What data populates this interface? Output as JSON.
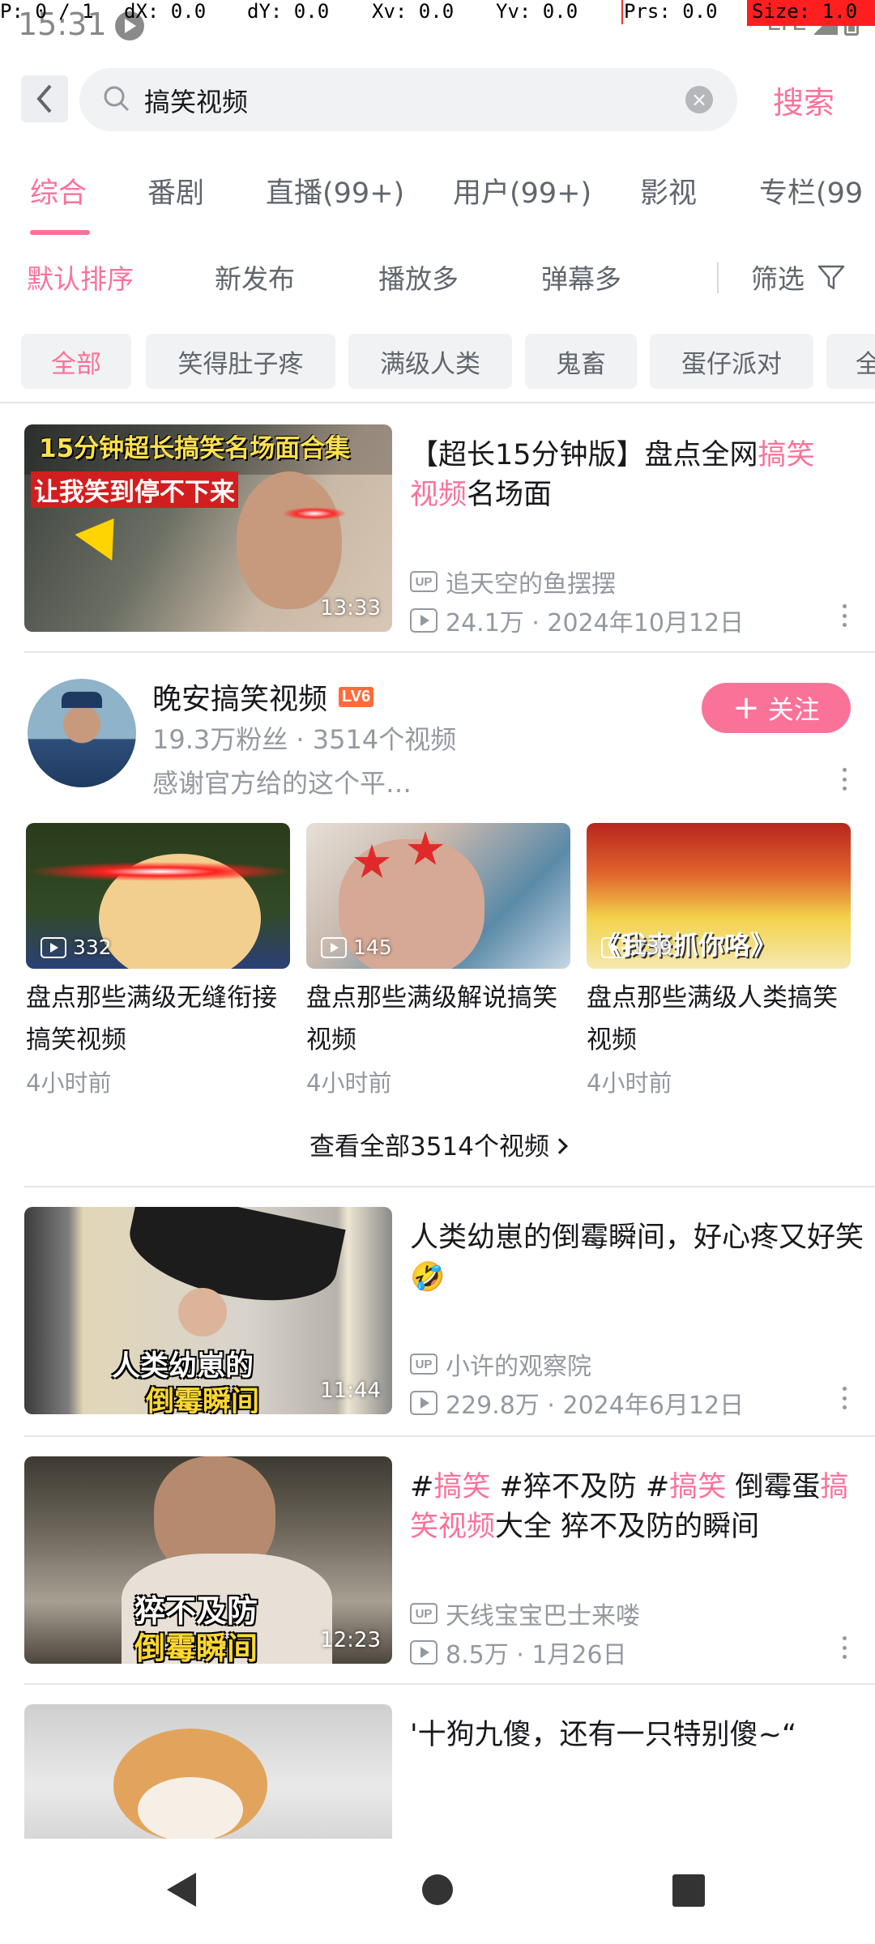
{
  "status_bar": {
    "time": "15:31",
    "network": "LTE"
  },
  "debug": {
    "p": "P: 0 / 1",
    "dx": "dX: 0.0",
    "dy": "dY: 0.0",
    "xv": "Xv: 0.0",
    "yv": "Yv: 0.0",
    "prs": "Prs: 0.0",
    "size": "Size: 1.0"
  },
  "search": {
    "query": "搞笑视频",
    "submit_label": "搜索"
  },
  "tabs": [
    "综合",
    "番剧",
    "直播(99+)",
    "用户(99+)",
    "影视",
    "专栏(99"
  ],
  "sort": {
    "options": [
      "默认排序",
      "新发布",
      "播放多",
      "弹幕多"
    ],
    "filter_label": "筛选"
  },
  "chips": [
    "全部",
    "笑得肚子疼",
    "满级人类",
    "鬼畜",
    "蛋仔派对",
    "全"
  ],
  "videos": [
    {
      "title_parts": [
        "【超长15分钟版】盘点全网",
        "搞笑",
        "\n",
        "视频",
        "名场面"
      ],
      "thumb_text_1": "15分钟超长搞笑名场面合集",
      "thumb_text_2": "让我笑到停不下来",
      "duration": "13:33",
      "uploader": "追天空的鱼摆摆",
      "stats": "24.1万 · 2024年10月12日"
    },
    {
      "title": "人类幼崽的倒霉瞬间，好心疼又好笑🤣",
      "thumb_text_1": "人类幼崽的",
      "thumb_text_2": "倒霉瞬间",
      "duration": "11:44",
      "uploader": "小许的观察院",
      "stats": "229.8万 · 2024年6月12日"
    },
    {
      "title_parts": [
        "#",
        "搞笑",
        " #猝不及防 #",
        "搞笑",
        " 倒霉蛋",
        "搞笑视频",
        "大全 猝不及防的瞬间"
      ],
      "thumb_text_1": "猝不及防",
      "thumb_text_2": "倒霉瞬间",
      "duration": "12:23",
      "uploader": "天线宝宝巴士来喽",
      "stats": "8.5万 · 1月26日"
    },
    {
      "title": "'十狗九傻，还有一只特别傻~“"
    }
  ],
  "user_card": {
    "name": "晚安搞笑视频",
    "level": "LV6",
    "stats": "19.3万粉丝 · 3514个视频",
    "description": "感谢官方给的这个平…",
    "follow_label": "关注",
    "videos": [
      {
        "views": "332",
        "title": "盘点那些满级无缝衔接搞笑视频",
        "time": "4小时前"
      },
      {
        "views": "145",
        "title": "盘点那些满级解说搞笑视频",
        "time": "4小时前",
        "thumb_text": ""
      },
      {
        "views": "139",
        "title": "盘点那些满级人类搞笑视频",
        "time": "4小时前",
        "thumb_text": "《我来抓你咯》"
      }
    ],
    "view_all_label": "查看全部3514个视频"
  },
  "colors": {
    "accent": "#fb7299",
    "text_primary": "#18191c",
    "text_secondary": "#9499a0"
  }
}
